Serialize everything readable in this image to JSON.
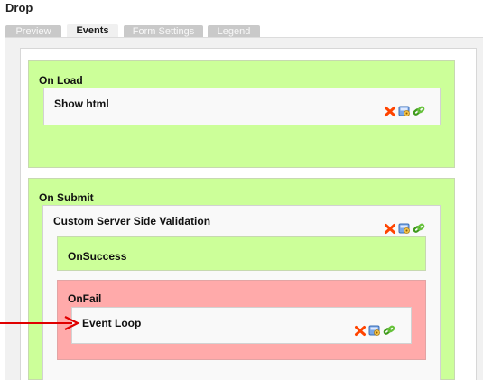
{
  "header": {
    "title": "Drop"
  },
  "tabs": [
    {
      "label": "Preview",
      "active": false
    },
    {
      "label": "Events",
      "active": true
    },
    {
      "label": "Form Settings",
      "active": false
    },
    {
      "label": "Legend",
      "active": false
    }
  ],
  "events": {
    "on_load": {
      "label": "On Load",
      "actions": [
        {
          "label": "Show html"
        }
      ]
    },
    "on_submit": {
      "label": "On Submit",
      "actions": [
        {
          "label": "Custom Server Side Validation",
          "on_success": {
            "label": "OnSuccess"
          },
          "on_fail": {
            "label": "OnFail",
            "actions": [
              {
                "label": "Event Loop"
              }
            ]
          }
        }
      ]
    }
  },
  "icons": {
    "delete": "delete-x-icon",
    "edit": "edit-settings-icon",
    "link": "link-chain-icon"
  },
  "colors": {
    "event_green": "#ccff99",
    "fail_red": "#ffaaaa",
    "arrow_red": "#e00000",
    "delete_orange": "#ff4400"
  }
}
